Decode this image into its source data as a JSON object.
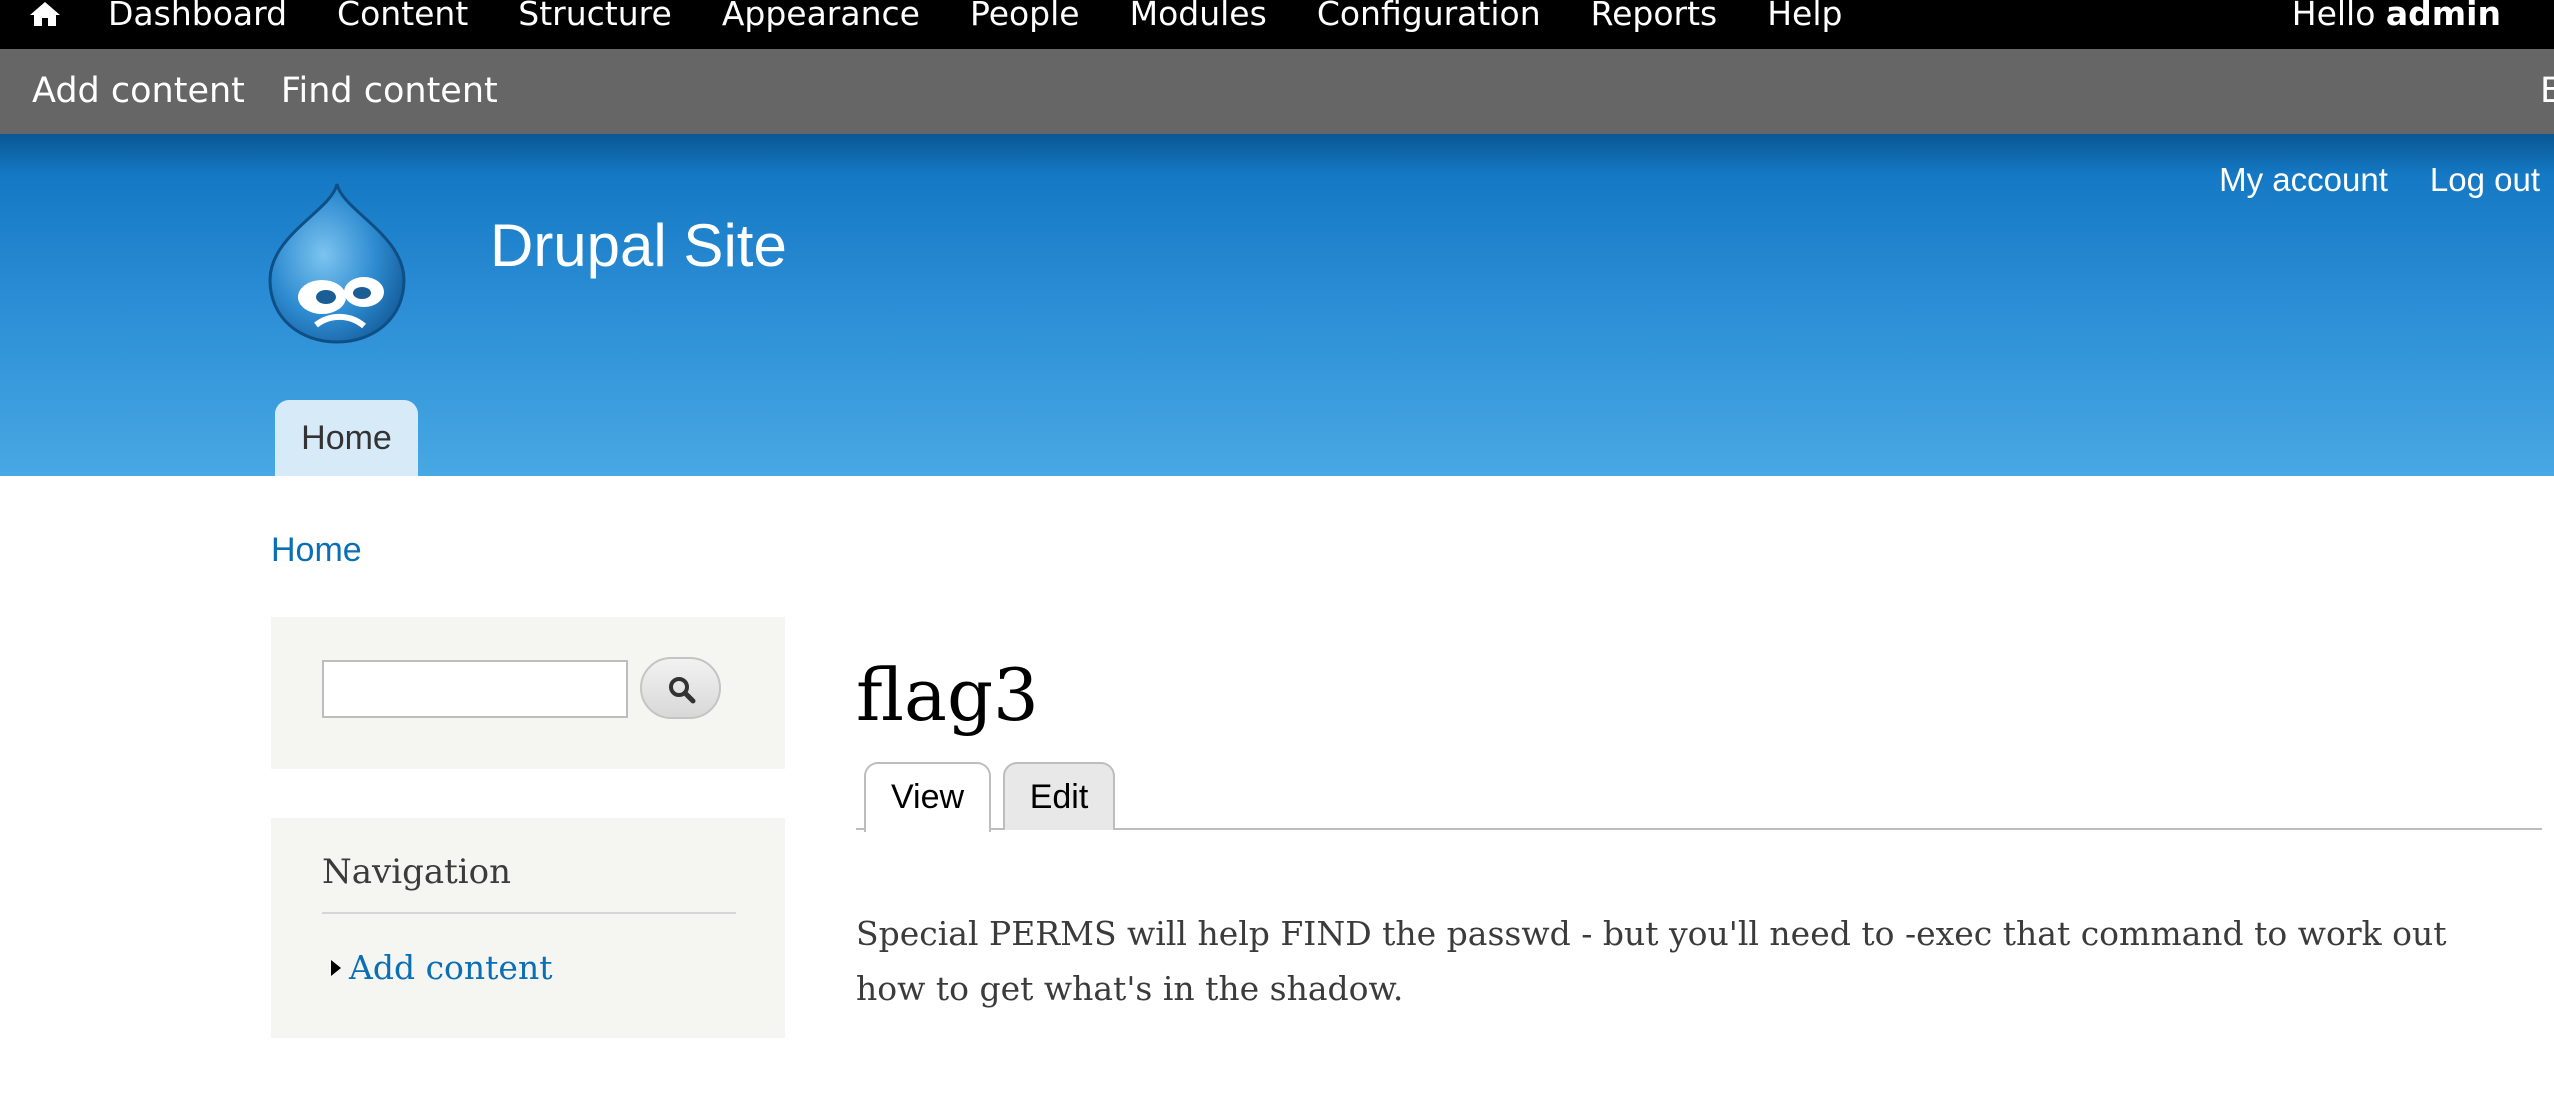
{
  "admin_toolbar": {
    "menu": [
      "Dashboard",
      "Content",
      "Structure",
      "Appearance",
      "People",
      "Modules",
      "Configuration",
      "Reports",
      "Help"
    ],
    "greeting_prefix": "Hello ",
    "username": "admin"
  },
  "shortcuts": {
    "items": [
      "Add content",
      "Find content"
    ],
    "edge_text": "E"
  },
  "header": {
    "site_name": "Drupal Site",
    "secondary_menu": [
      "My account",
      "Log out"
    ],
    "main_menu_home": "Home"
  },
  "breadcrumb": "Home",
  "sidebar": {
    "navigation_title": "Navigation",
    "navigation_items": [
      "Add content"
    ]
  },
  "main": {
    "title": "flag3",
    "tabs": [
      "View",
      "Edit"
    ],
    "active_tab": "View",
    "body": "Special PERMS will help FIND the passwd - but you'll need to -exec that command to work out how to get what's in the shadow."
  },
  "colors": {
    "admin_bar": "#000000",
    "shortcut_bar": "#666666",
    "header_top": "#0a5793",
    "header_bottom": "#48a8e4",
    "link": "#0a6fb5"
  }
}
